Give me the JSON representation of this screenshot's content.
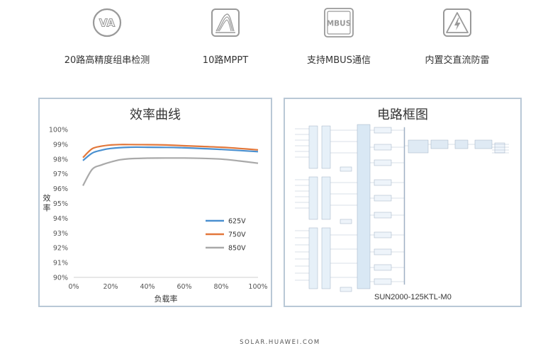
{
  "features": [
    {
      "icon": "va-icon",
      "label": "20路高精度组串检测"
    },
    {
      "icon": "curve-icon",
      "label": "10路MPPT"
    },
    {
      "icon": "mbus-icon",
      "label": "支持MBUS通信"
    },
    {
      "icon": "lightning-icon",
      "label": "内置交直流防雷"
    }
  ],
  "icon_text": {
    "va": "VA",
    "mbus": "MBUS"
  },
  "chart_panel": {
    "title": "效率曲线"
  },
  "diagram_panel": {
    "title": "电路框图",
    "model": "SUN2000-125KTL-M0"
  },
  "chart_data": {
    "type": "line",
    "title": "效率曲线",
    "xlabel": "负载率",
    "ylabel": "效率",
    "xlim": [
      0,
      100
    ],
    "ylim": [
      90,
      100
    ],
    "xticks": [
      "0%",
      "20%",
      "40%",
      "60%",
      "80%",
      "100%"
    ],
    "yticks": [
      "90%",
      "91%",
      "92%",
      "93%",
      "94%",
      "95%",
      "96%",
      "97%",
      "98%",
      "99%",
      "100%"
    ],
    "grid": false,
    "legend": "bottom-right",
    "series": [
      {
        "name": "625V",
        "color": "#4a90d0",
        "x": [
          5,
          10,
          15,
          20,
          30,
          40,
          50,
          60,
          70,
          80,
          90,
          100
        ],
        "y": [
          97.9,
          98.4,
          98.6,
          98.72,
          98.8,
          98.8,
          98.79,
          98.76,
          98.71,
          98.65,
          98.58,
          98.5
        ]
      },
      {
        "name": "750V",
        "color": "#e2773a",
        "x": [
          5,
          10,
          15,
          20,
          25,
          30,
          40,
          50,
          60,
          70,
          80,
          90,
          100
        ],
        "y": [
          98.1,
          98.7,
          98.87,
          98.95,
          98.98,
          98.98,
          98.97,
          98.95,
          98.9,
          98.85,
          98.8,
          98.72,
          98.62
        ]
      },
      {
        "name": "850V",
        "color": "#a9a9a9",
        "x": [
          5,
          10,
          15,
          20,
          25,
          30,
          40,
          50,
          60,
          70,
          80,
          90,
          100
        ],
        "y": [
          96.2,
          97.3,
          97.6,
          97.8,
          97.95,
          98.02,
          98.06,
          98.07,
          98.07,
          98.05,
          98.0,
          97.87,
          97.72
        ]
      }
    ]
  }
}
